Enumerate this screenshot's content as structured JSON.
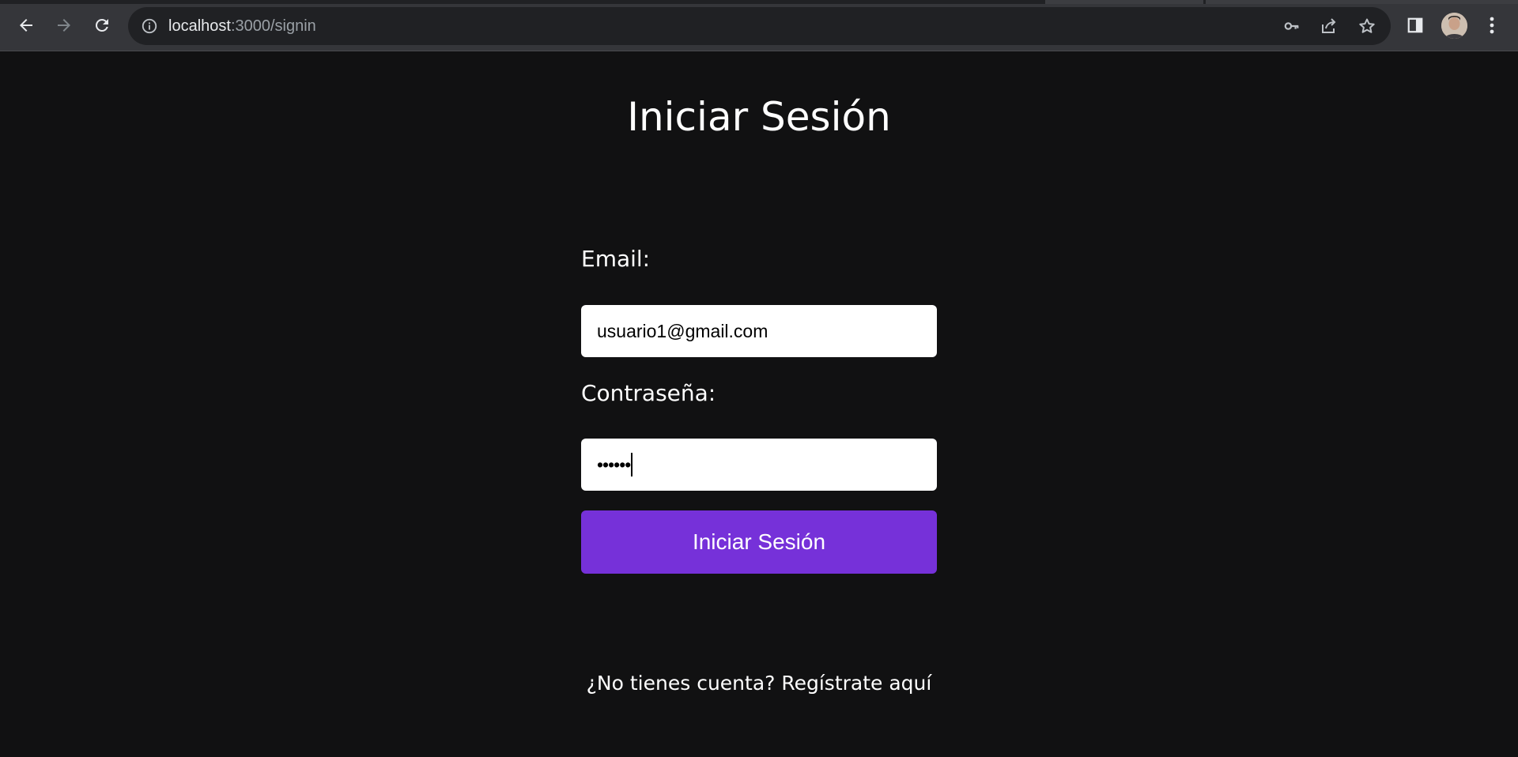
{
  "browser": {
    "url_host": "localhost",
    "url_rest": ":3000/signin",
    "icons": {
      "back": "arrow-left-icon",
      "forward": "arrow-right-icon",
      "reload": "reload-icon",
      "info": "info-icon",
      "password_key": "key-icon",
      "share": "share-icon",
      "bookmark": "star-icon",
      "side_panel": "side-panel-icon",
      "profile": "avatar",
      "menu": "kebab-menu-icon"
    }
  },
  "page": {
    "title": "Iniciar Sesión",
    "email_label": "Email:",
    "email_value": "usuario1@gmail.com",
    "password_label": "Contraseña:",
    "password_value": "••••••",
    "submit_label": "Iniciar Sesión",
    "signup_prompt": "¿No tienes cuenta?",
    "signup_link": "Regístrate aquí"
  },
  "colors": {
    "background": "#111112",
    "accent_button": "#7631d9",
    "toolbar": "#35363a",
    "omnibox": "#202124"
  }
}
